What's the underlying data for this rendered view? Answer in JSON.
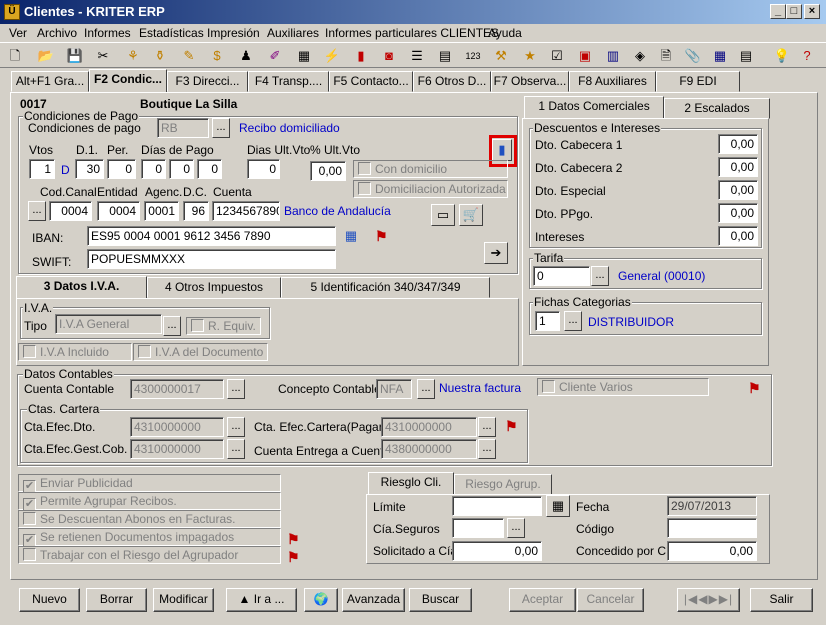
{
  "window": {
    "title": "Clientes - KRITER ERP",
    "app_icon": "kriter-app-icon",
    "min": "_",
    "max": "□",
    "close": "×"
  },
  "menu": [
    "Ver",
    "Archivo",
    "Informes",
    "Estadísticas",
    "Impresión",
    "Auxiliares",
    "Informes particulares CLIENTES",
    "Ayuda"
  ],
  "toolbar_icons": [
    "new-document-icon",
    "open-folder-icon",
    "save-icon",
    "scissors-icon",
    "tree-icon",
    "filter-icon",
    "pen-icon",
    "dollar-icon",
    "stamp-icon",
    "brush-icon",
    "grid-icon",
    "lightning-icon",
    "bar-chart-icon",
    "camera-icon",
    "list-icon",
    "numbers-icon",
    "tools-icon",
    "folder-star-icon",
    "document-check-icon",
    "calendar-icon",
    "tag-icon",
    "document-icon",
    "paperclip-icon",
    "table-icon",
    "sheet-icon",
    "lightbulb-icon",
    "help-icon"
  ],
  "tabs": [
    "Alt+F1 Gra...",
    "F2 Condic...",
    "F3 Direcci...",
    "F4 Transp....",
    "F5 Contacto...",
    "F6 Otros D...",
    "F7 Observa...",
    "F8 Auxiliares",
    "F9 EDI"
  ],
  "header": {
    "code": "0017",
    "name": "Boutique La Silla"
  },
  "cond_pago": {
    "group_label": "Condiciones de Pago",
    "field_label": "Condiciones de pago",
    "value": "RB",
    "desc": "Recibo domiciliado",
    "vtos_label": "Vtos",
    "vtos": "1",
    "vtos_unit": "D",
    "d1_label": "D.1.",
    "d1": "30",
    "per_label": "Per.",
    "per": "0",
    "dias_pago_label": "Días de Pago",
    "dias_pago": [
      "0",
      "0",
      "0"
    ],
    "dias_ult_vto_label": "Dias Ult.Vto",
    "dias_ult_vto": "0",
    "pct_ult_vto_label": "% Ult.Vto",
    "pct_ult_vto": "0,00",
    "con_domicilio": "Con domicilio",
    "domiciliacion_autorizada": "Domiciliacion Autorizada",
    "cod_canal_label": "Cod.Canal",
    "cod_canal": "0004",
    "entidad_label": "Entidad",
    "entidad": "0004",
    "agencia_label": "Agenc.",
    "agencia": "0001",
    "dc_label": "D.C.",
    "dc": "96",
    "cuenta_label": "Cuenta",
    "cuenta": "1234567890",
    "banco": "Banco de Andalucía",
    "iban_label": "IBAN:",
    "iban": "ES95 0004 0001 9612 3456 7890",
    "swift_label": "SWIFT:",
    "swift": "POPUESMMXXX"
  },
  "subtabs_left": [
    "3 Datos I.V.A.",
    "4 Otros Impuestos",
    "5 Identificación 340/347/349"
  ],
  "iva": {
    "group_label": "I.V.A.",
    "tipo_label": "Tipo",
    "tipo": "I.V.A General",
    "r_equiv": "R. Equiv.",
    "iva_incluido": "I.V.A Incluido",
    "iva_documento": "I.V.A del Documento"
  },
  "subtabs_right": [
    "1 Datos Comerciales",
    "2 Escalados"
  ],
  "descuentos": {
    "group_label": "Descuentos e Intereses",
    "rows": [
      {
        "label": "Dto. Cabecera 1",
        "value": "0,00"
      },
      {
        "label": "Dto. Cabecera 2",
        "value": "0,00"
      },
      {
        "label": "Dto. Especial",
        "value": "0,00"
      },
      {
        "label": "Dto. PPgo.",
        "value": "0,00"
      },
      {
        "label": "Intereses",
        "value": "0,00"
      }
    ]
  },
  "tarifa": {
    "group_label": "Tarifa",
    "value": "0",
    "desc": "General (00010)"
  },
  "fichas": {
    "group_label": "Fichas Categorias",
    "value": "1",
    "desc": "DISTRIBUIDOR"
  },
  "contables": {
    "group_label": "Datos Contables",
    "cuenta_label": "Cuenta Contable",
    "cuenta": "4300000017",
    "concepto_label": "Concepto Contable",
    "concepto": "NFA",
    "concepto_desc": "Nuestra factura",
    "cliente_varios": "Cliente Varios",
    "cartera_label": "Ctas. Cartera",
    "efec_dto_label": "Cta.Efec.Dto.",
    "efec_dto": "4310000000",
    "efec_gest_label": "Cta.Efec.Gest.Cob.",
    "efec_gest": "4310000000",
    "efec_pagare_label": "Cta. Efec.Cartera(Pagaré)",
    "efec_pagare": "4310000000",
    "entrega_label": "Cuenta Entrega a Cuenta",
    "entrega": "4380000000"
  },
  "checks": [
    {
      "label": "Enviar Publicidad",
      "checked": true
    },
    {
      "label": "Permite Agrupar Recibos.",
      "checked": true
    },
    {
      "label": "Se Descuentan Abonos en Facturas.",
      "checked": false
    },
    {
      "label": "Se retienen Documentos impagados",
      "checked": true
    },
    {
      "label": "Trabajar con el Riesgo del Agrupador",
      "checked": false
    }
  ],
  "riesgo": {
    "tabs": [
      "Riesglo Cli.",
      "Riesgo Agrup."
    ],
    "limite_label": "Límite",
    "limite": "",
    "cia_label": "Cía.Seguros",
    "cia": "",
    "solicitado_label": "Solicitado a Cía",
    "solicitado": "0,00",
    "fecha_label": "Fecha",
    "fecha": "29/07/2013",
    "codigo_label": "Código",
    "codigo": "",
    "concedido_label": "Concedido por Cía",
    "concedido": "0,00"
  },
  "buttons": {
    "nuevo": "Nuevo",
    "borrar": "Borrar",
    "modificar": "Modificar",
    "ir_a": "Ir a ...",
    "avanzada": "Avanzada",
    "buscar": "Buscar",
    "aceptar": "Aceptar",
    "cancelar": "Cancelar",
    "salir": "Salir"
  }
}
